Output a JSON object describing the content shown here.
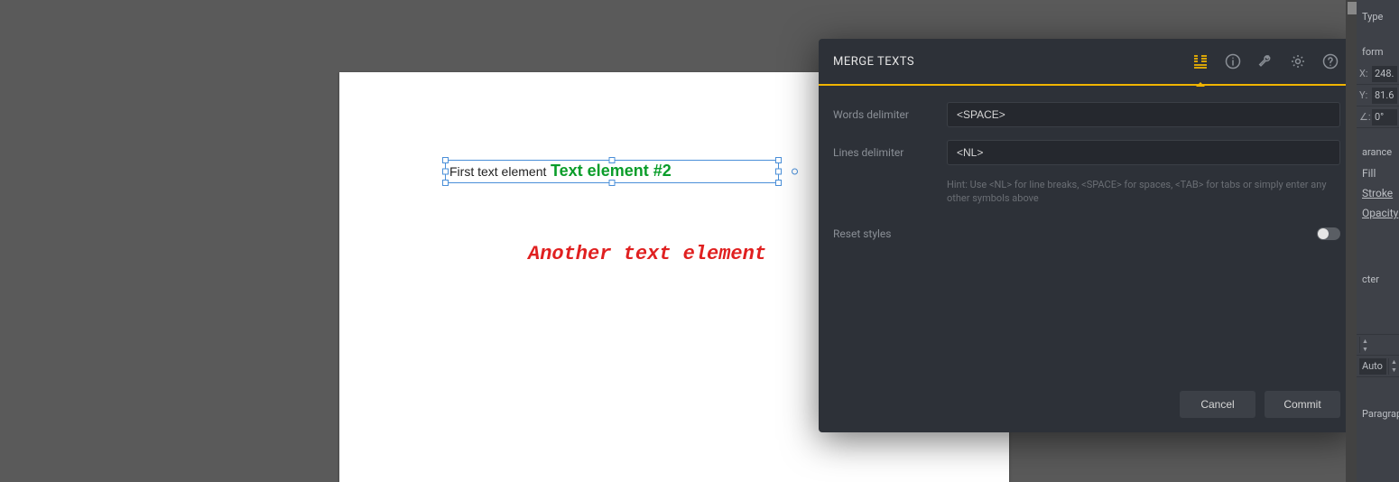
{
  "canvas": {
    "text1": "First text element",
    "text2": "Text element #2",
    "text3": "Another text element"
  },
  "dialog": {
    "title": "MERGE TEXTS",
    "words_label": "Words delimiter",
    "words_value": "<SPACE>",
    "lines_label": "Lines delimiter",
    "lines_value": "<NL>",
    "hint": "Hint: Use <NL> for line breaks, <SPACE> for spaces, <TAB> for tabs or simply enter any other symbols above",
    "reset_label": "Reset styles",
    "cancel": "Cancel",
    "commit": "Commit"
  },
  "props": {
    "type_title": "Type",
    "transform_title": "form",
    "x_label": "X:",
    "x_value": "248.",
    "y_label": "Y:",
    "y_value": "81.6",
    "angle_label": "∠:",
    "angle_value": "0°",
    "appearance_title": "arance",
    "fill": "Fill",
    "stroke": "Stroke",
    "opacity": "Opacity",
    "character_title": "cter",
    "auto": "Auto",
    "paragraph_title": "Paragraph"
  }
}
